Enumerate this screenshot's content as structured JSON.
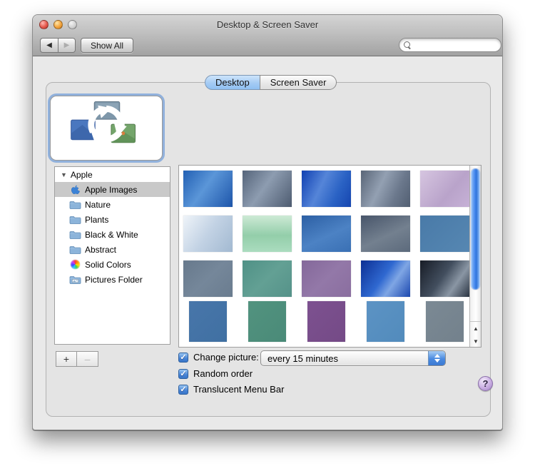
{
  "window": {
    "title": "Desktop & Screen Saver"
  },
  "toolbar": {
    "back_label": "◀",
    "forward_label": "▶",
    "show_all_label": "Show All",
    "search_placeholder": ""
  },
  "tabs": {
    "desktop": "Desktop",
    "screen_saver": "Screen Saver"
  },
  "preview": {
    "icon": "rotating-pictures-icon"
  },
  "sidebar": {
    "disclosure": "▼",
    "group_label": "Apple",
    "items": [
      {
        "label": "Apple Images",
        "icon": "apple",
        "selected": true
      },
      {
        "label": "Nature",
        "icon": "folder",
        "selected": false
      },
      {
        "label": "Plants",
        "icon": "folder",
        "selected": false
      },
      {
        "label": "Black & White",
        "icon": "folder",
        "selected": false
      },
      {
        "label": "Abstract",
        "icon": "folder",
        "selected": false
      },
      {
        "label": "Solid Colors",
        "icon": "colorwheel",
        "selected": false
      },
      {
        "label": "Pictures Folder",
        "icon": "picturesfolder",
        "selected": false
      }
    ],
    "add_label": "+",
    "remove_label": "–"
  },
  "grid": {
    "rows": [
      {
        "square": false,
        "thumbs": [
          {
            "name": "aqua-blue-swirl",
            "bg": "linear-gradient(125deg,#2260b4 0%,#5b96d8 45%,#1d55aa 100%)"
          },
          {
            "name": "graphite-swirl",
            "bg": "linear-gradient(125deg,#55647a 0%,#8d9cb0 45%,#4d5b70 100%)"
          },
          {
            "name": "deep-blue-flow",
            "bg": "linear-gradient(115deg,#1040b2 0%,#5585d8 40%,#2a62c4 70%,#1646b0 100%)"
          },
          {
            "name": "graphite-flow",
            "bg": "linear-gradient(115deg,#596577 0%,#93a0b2 40%,#6b788c 70%,#525f72 100%)"
          },
          {
            "name": "lavender-rays",
            "bg": "linear-gradient(130deg,#d6c5e0 0%,#b9a3ca 60%,#c6b1d6 100%)"
          }
        ]
      },
      {
        "square": false,
        "thumbs": [
          {
            "name": "silver-ridge",
            "bg": "linear-gradient(125deg,#eff4f9 0%,#c2d2e4 50%,#a2b9d1 100%)"
          },
          {
            "name": "sea-mist-green",
            "bg": "linear-gradient(180deg,#cdead5 0%,#93ceaa 55%,#abdcbf 100%)"
          },
          {
            "name": "blue-arcs",
            "bg": "linear-gradient(155deg,#2c5fa4 0%,#4c82c4 55%,#3a70b4 100%)"
          },
          {
            "name": "graphite-arcs",
            "bg": "linear-gradient(155deg,#48556a 0%,#73808f 55%,#5c6a7c 100%)"
          },
          {
            "name": "steel-blue",
            "bg": "linear-gradient(135deg,#497aa8 0%,#5687b2 100%)"
          }
        ]
      },
      {
        "square": false,
        "thumbs": [
          {
            "name": "slate-weave",
            "bg": "linear-gradient(135deg,#67798c 0%,#75879a 50%,#6a7c8f 100%)"
          },
          {
            "name": "teal-weave",
            "bg": "linear-gradient(135deg,#4f9186 0%,#63a094 50%,#559289 100%)"
          },
          {
            "name": "plum-weave",
            "bg": "linear-gradient(135deg,#84689a 0%,#9378a8 50%,#8a6e9f 100%)"
          },
          {
            "name": "cobalt-flow",
            "bg": "linear-gradient(125deg,#0c2f94 0%,#2f68d0 45%,#7fa6e4 65%,#1b47ae 100%)"
          },
          {
            "name": "charcoal-flow",
            "bg": "linear-gradient(125deg,#171c26 0%,#424e5e 45%,#8a96a4 70%,#2a3442 100%)"
          }
        ]
      },
      {
        "square": true,
        "thumbs": [
          {
            "name": "solid-blue",
            "bg": "linear-gradient(135deg,#4876aa 0%,#4070a2 100%)"
          },
          {
            "name": "solid-teal",
            "bg": "linear-gradient(135deg,#52937f 0%,#4a8a78 100%)"
          },
          {
            "name": "solid-plum",
            "bg": "linear-gradient(135deg,#7d5190 0%,#744a86 100%)"
          },
          {
            "name": "solid-sky",
            "bg": "linear-gradient(135deg,#5c93c4 0%,#528bbc 100%)"
          },
          {
            "name": "solid-gray",
            "bg": "linear-gradient(135deg,#7b8994 0%,#73818c 100%)"
          }
        ]
      }
    ],
    "scrollbar": {
      "up_label": "▲",
      "down_label": "▼"
    }
  },
  "footer": {
    "change_picture_label": "Change picture:",
    "change_picture_value": "every 15 minutes",
    "random_order_label": "Random order",
    "translucent_label": "Translucent Menu Bar",
    "check_glyph": "✓",
    "help_label": "?"
  },
  "colors": {
    "tab_active": "#8fc0f2",
    "selection_gray": "#c9c9c9",
    "scroll_thumb_blue": "#2f74dc",
    "checkbox_blue": "#3a76c8",
    "focus_ring_blue": "#75a0d9"
  }
}
